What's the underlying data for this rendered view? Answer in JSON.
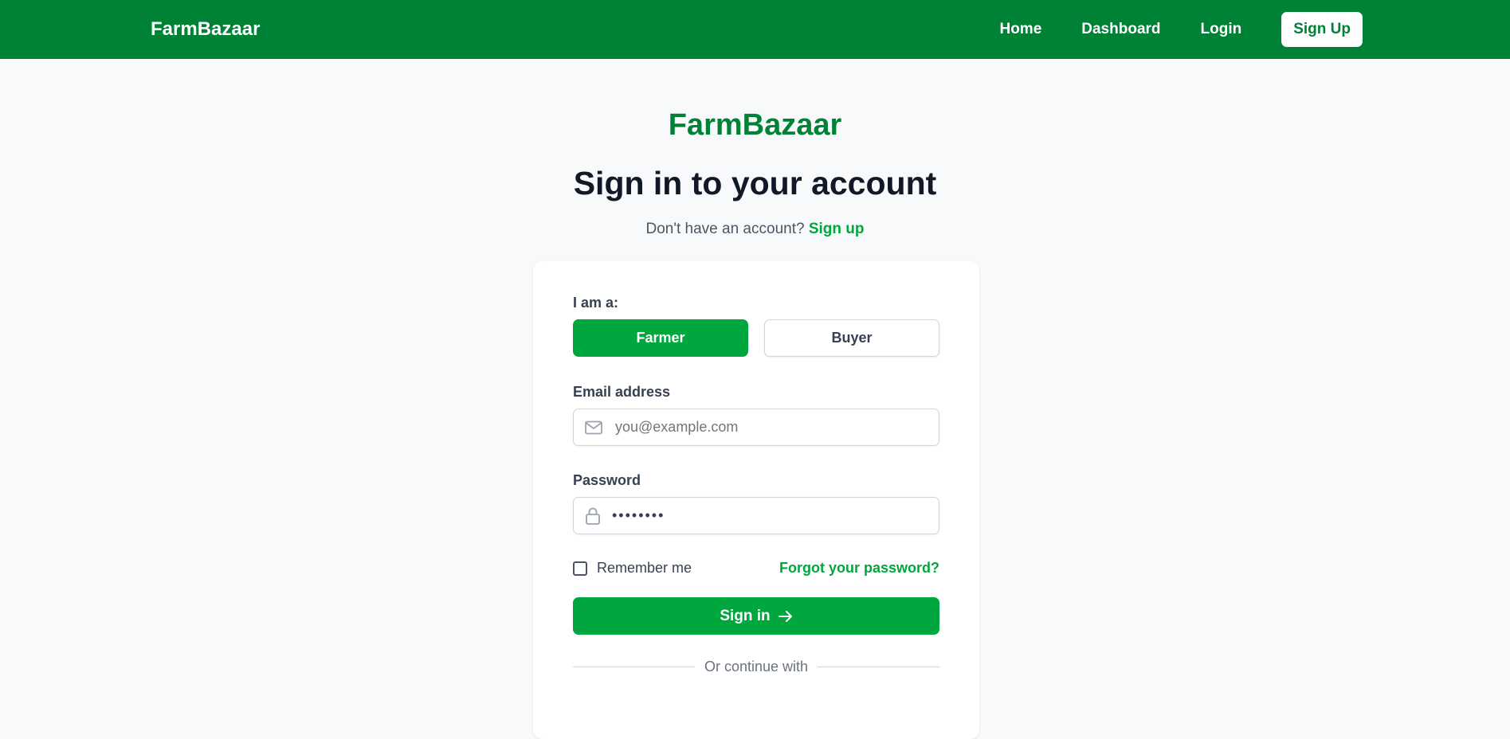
{
  "nav": {
    "brand": "FarmBazaar",
    "links": [
      "Home",
      "Dashboard",
      "Login"
    ],
    "signup": "Sign Up"
  },
  "hero": {
    "logo": "FarmBazaar",
    "title": "Sign in to your account",
    "prompt": "Don't have an account?",
    "signup_link": "Sign up"
  },
  "form": {
    "role_label": "I am a:",
    "roles": [
      "Farmer",
      "Buyer"
    ],
    "selected_role": "Farmer",
    "email_label": "Email address",
    "email_placeholder": "you@example.com",
    "password_label": "Password",
    "password_value": "••••••••",
    "remember": "Remember me",
    "forgot": "Forgot your password?",
    "submit": "Sign in",
    "divider": "Or continue with"
  },
  "colors": {
    "brand_dark": "#008236",
    "brand_accent": "#00a63e"
  },
  "icons": {
    "email": "mail-icon",
    "password": "lock-icon",
    "submit": "arrow-right-icon"
  }
}
